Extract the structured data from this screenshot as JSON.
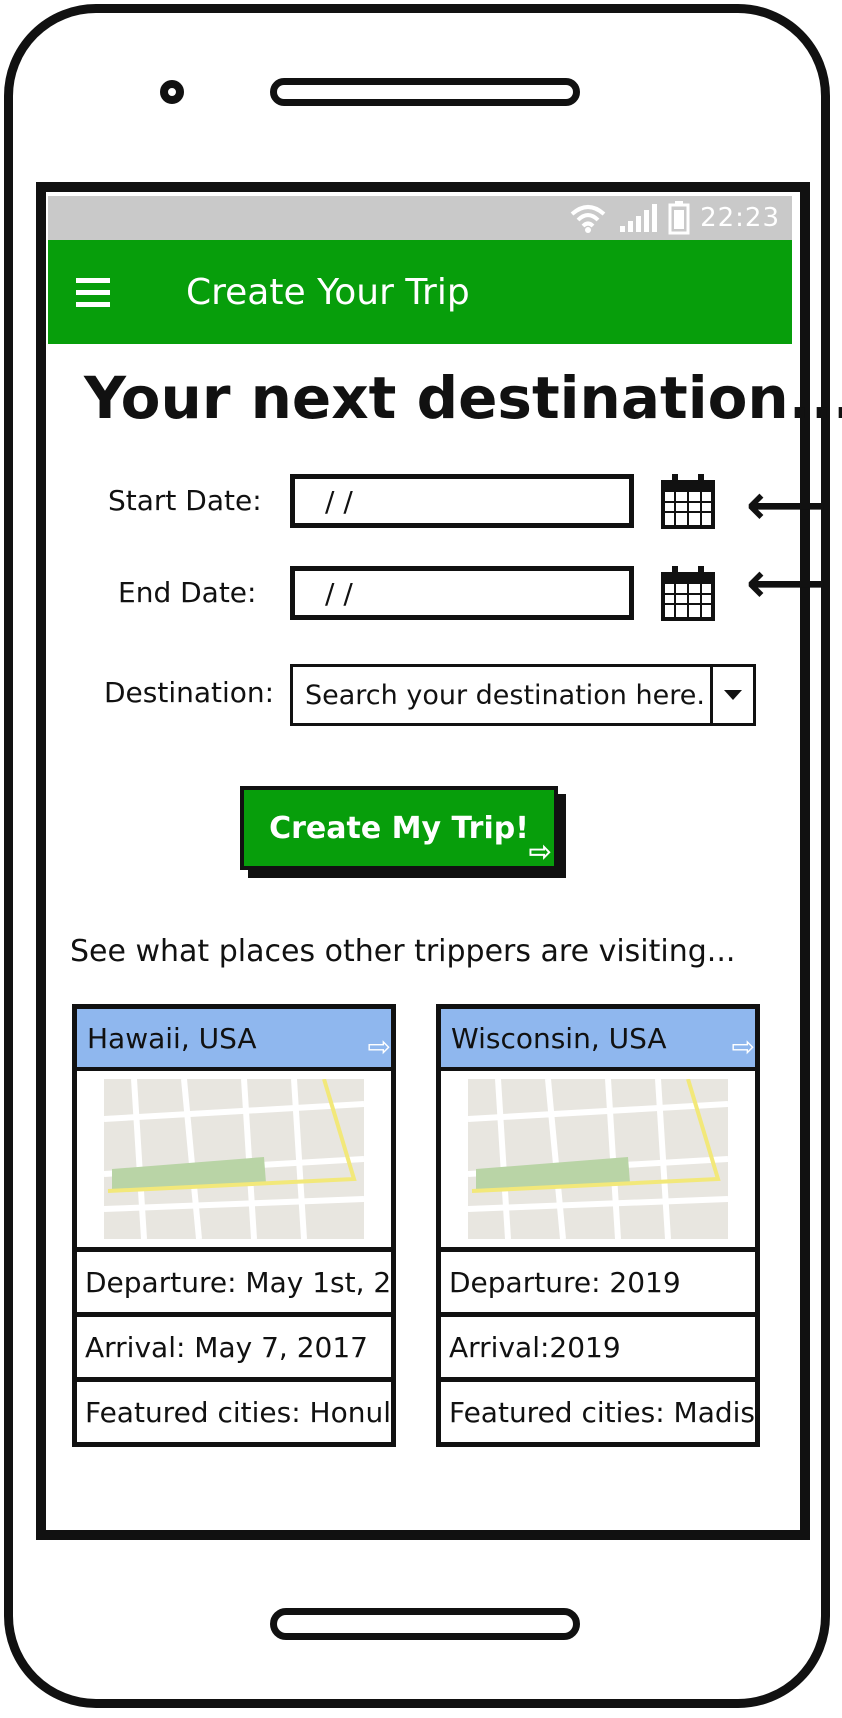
{
  "status_bar": {
    "time": "22:23",
    "icons": [
      "wifi-icon",
      "signal-icon",
      "battery-icon"
    ]
  },
  "app_bar": {
    "title": "Create Your Trip",
    "menu_icon": "hamburger-menu-icon"
  },
  "heading": "Your next destination...",
  "form": {
    "start_label": "Start Date:",
    "start_value": "/ /",
    "end_label": "End Date:",
    "end_value": "/ /",
    "destination_label": "Destination:",
    "destination_placeholder": "Search your destination here...",
    "destination_visible": "Search your destination here."
  },
  "cta": {
    "label": "Create My Trip!"
  },
  "section_title": "See what places other trippers are visiting...",
  "cards": [
    {
      "title": "Hawaii, USA",
      "departure": "Departure: May 1st, 2",
      "arrival": "Arrival: May 7, 2017",
      "cities": "Featured cities: Honul"
    },
    {
      "title": "Wisconsin, USA",
      "departure": "Departure: 2019",
      "arrival": "Arrival:2019",
      "cities": "Featured cities: Madis"
    }
  ],
  "colors": {
    "accent": "#079e0b",
    "card_header": "#8fb7ee",
    "status_bar": "#c9c9c9"
  }
}
